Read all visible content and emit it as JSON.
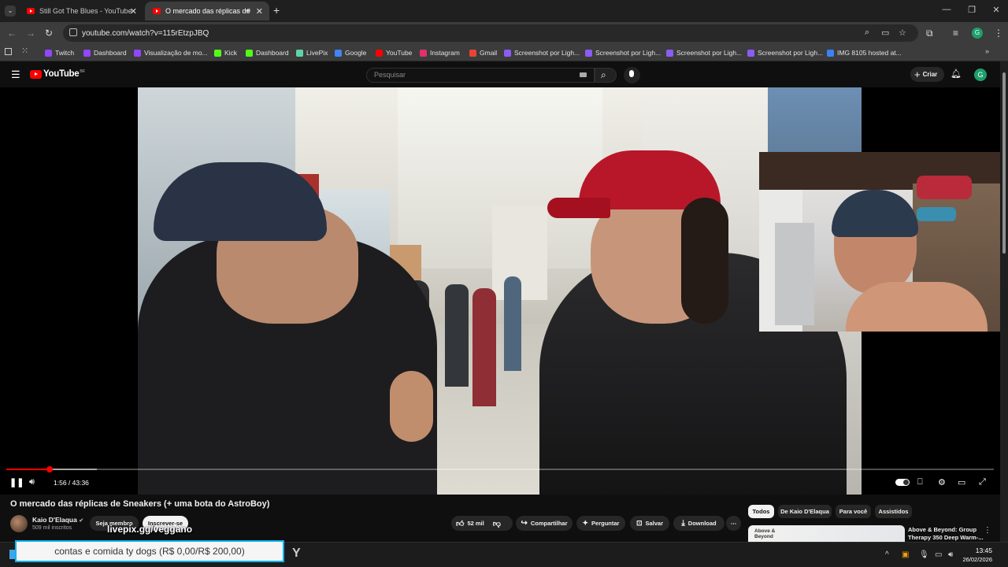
{
  "browser": {
    "tabs": [
      {
        "title": "Still Got The Blues - YouTube",
        "active": false
      },
      {
        "title": "O mercado das réplicas de",
        "active": true
      }
    ],
    "new_tab": "+",
    "url": "youtube.com/watch?v=115rEtzpJBQ",
    "bookmarks": [
      {
        "label": "Twitch",
        "color": "#9146ff"
      },
      {
        "label": "Dashboard",
        "color": "#9146ff"
      },
      {
        "label": "Visualização de mo...",
        "color": "#9146ff"
      },
      {
        "label": "Kick",
        "color": "#53fc18"
      },
      {
        "label": "Dashboard",
        "color": "#53fc18"
      },
      {
        "label": "LivePix",
        "color": "#5fd3a8"
      },
      {
        "label": "Google",
        "color": "#4285f4"
      },
      {
        "label": "YouTube",
        "color": "#ff0000"
      },
      {
        "label": "Instagram",
        "color": "#e1306c"
      },
      {
        "label": "Gmail",
        "color": "#ea4335"
      },
      {
        "label": "Screenshot por Ligh...",
        "color": "#8b5cf6"
      },
      {
        "label": "Screenshot por Ligh...",
        "color": "#8b5cf6"
      },
      {
        "label": "Screenshot por Ligh...",
        "color": "#8b5cf6"
      },
      {
        "label": "Screenshot por Ligh...",
        "color": "#8b5cf6"
      },
      {
        "label": "IMG 8105 hosted at...",
        "color": "#3b82f6"
      }
    ],
    "profile_initial": "G"
  },
  "youtube": {
    "logo_text": "YouTube",
    "logo_country": "BR",
    "search_placeholder": "Pesquisar",
    "create_label": "Criar",
    "avatar_initial": "G"
  },
  "player": {
    "current_time": "1:56",
    "separator": " / ",
    "duration": "43:36",
    "played_fraction": 0.044,
    "buffered_fraction": 0.092,
    "autoplay_on": true
  },
  "video": {
    "title": "O mercado das réplicas de Sneakers (+ uma bota do AstroBoy)",
    "channel": "Kaio D'Elaqua",
    "verified": true,
    "subscribers": "509 mil inscritos",
    "member_label": "Seja membro",
    "subscribe_label": "Inscrever-se",
    "likes": "52 mil",
    "share_label": "Compartilhar",
    "ask_label": "Perguntar",
    "save_label": "Salvar",
    "download_label": "Download"
  },
  "recommendations": {
    "chips": [
      "Todos",
      "De Kaio D'Elaqua",
      "Para você",
      "Assistidos"
    ],
    "first": {
      "thumb_text": "Above & Beyond",
      "title": "Above & Beyond: Group Therapy 350 Deep Warm-..."
    }
  },
  "overlay": {
    "livepix": "livepix.gg/veggano",
    "donation_text": "contas e comida ty dogs (R$ 0,00/R$ 200,00)",
    "extra_glyph": "Y"
  },
  "taskbar": {
    "time": "13:45",
    "date": "26/02/2026"
  }
}
